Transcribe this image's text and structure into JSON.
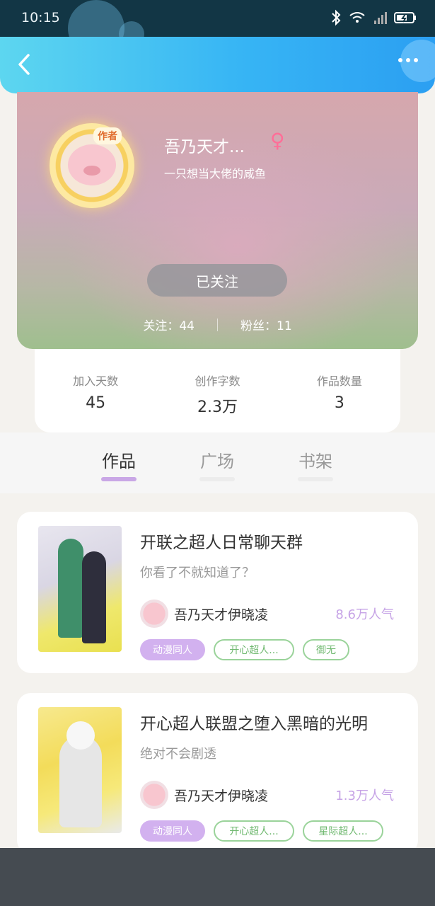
{
  "status_bar": {
    "time": "10:15",
    "icons": [
      "bluetooth-icon",
      "wifi-icon",
      "signal-icon",
      "battery-icon"
    ]
  },
  "header": {
    "back_icon": "chevron-left-icon",
    "more_icon": "more-dots-icon"
  },
  "profile": {
    "avatar_badge": "作者",
    "name": "吾乃天才...",
    "gender_symbol": "♀",
    "bio": "一只想当大佬的咸鱼",
    "follow_button": "已关注",
    "following_label": "关注：",
    "following_count": "44",
    "fans_label": "粉丝：",
    "fans_count": "11"
  },
  "stats": [
    {
      "label": "加入天数",
      "value": "45"
    },
    {
      "label": "创作字数",
      "value": "2.3万"
    },
    {
      "label": "作品数量",
      "value": "3"
    }
  ],
  "tabs": [
    {
      "label": "作品",
      "active": true
    },
    {
      "label": "广场",
      "active": false
    },
    {
      "label": "书架",
      "active": false
    }
  ],
  "works": [
    {
      "title": "开联之超人日常聊天群",
      "desc": "你看了不就知道了？",
      "author": "吾乃天才伊晓凌",
      "popularity": "8.6万人气",
      "tags": [
        "动漫同人",
        "开心超人...",
        "御无"
      ]
    },
    {
      "title": "开心超人联盟之堕入黑暗的光明",
      "desc": "绝对不会剧透",
      "author": "吾乃天才伊晓凌",
      "popularity": "1.3万人气",
      "tags": [
        "动漫同人",
        "开心超人...",
        "星际超人..."
      ]
    }
  ],
  "colors": {
    "accent": "#c9a7e6",
    "header": "#37b5f4",
    "tag_filled": "#d2b1ef",
    "tag_outline": "#9ad39a"
  }
}
